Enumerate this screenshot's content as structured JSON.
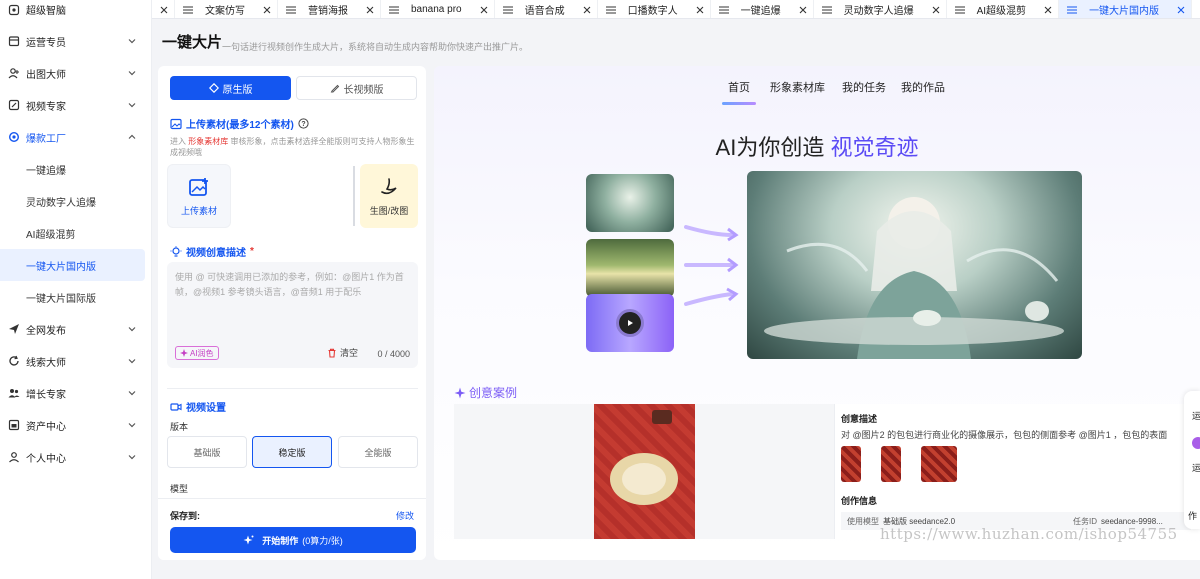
{
  "sidebar": {
    "items": [
      {
        "label": "超级智脑",
        "icon": "brain-icon"
      },
      {
        "label": "运营专员",
        "icon": "calendar-icon"
      },
      {
        "label": "出图大师",
        "icon": "user-plus-icon"
      },
      {
        "label": "视频专家",
        "icon": "video-edit-icon"
      },
      {
        "label": "爆款工厂",
        "icon": "gear-icon"
      },
      {
        "label": "全网发布",
        "icon": "send-icon"
      },
      {
        "label": "线索大师",
        "icon": "refresh-icon"
      },
      {
        "label": "增长专家",
        "icon": "user-group-icon"
      },
      {
        "label": "资产中心",
        "icon": "folder-icon"
      },
      {
        "label": "个人中心",
        "icon": "person-icon"
      }
    ],
    "subitems": [
      "一键追爆",
      "灵动数字人追爆",
      "AI超级混剪",
      "一键大片国内版",
      "一键大片国际版"
    ]
  },
  "tabs": [
    "",
    "文案仿写",
    "营销海报",
    "banana pro",
    "语音合成",
    "口播数字人",
    "一键追爆",
    "灵动数字人追爆",
    "AI超级混剪",
    "一键大片国内版"
  ],
  "page": {
    "title": "一键大片",
    "subtitle": "一句话进行视频创作生成大片，系统将自动生成内容帮助你快速产出推广片。"
  },
  "form": {
    "mode_primary": "原生版",
    "mode_secondary": "长视频版",
    "upload_title": "上传素材(最多12个素材)",
    "hint_prefix": "进入",
    "hint_link": "形象素材库",
    "hint_suffix": "审核形象，点击素材选择全能版则可支持人物形象生成视频哦",
    "upload_label": "上传素材",
    "gen_label": "生图/改图",
    "desc_title": "视频创意描述",
    "required_mark": "*",
    "desc_placeholder": "使用 @ 可快速调用已添加的参考，例如：@图片1 作为首帧，@视频1 参考镜头语言，@音频1 用于配乐",
    "ai_polish": "AI润色",
    "clear": "清空",
    "counter": "0 / 4000",
    "settings_title": "视频设置",
    "version_label": "版本",
    "versions": [
      "基础版",
      "稳定版",
      "全能版"
    ],
    "model_label": "模型",
    "save_to": "保存到:",
    "modify": "修改",
    "start": "开始制作",
    "start_cost": "(0算力/张)"
  },
  "content": {
    "nav": [
      "首页",
      "形象素材库",
      "我的任务",
      "我的作品"
    ],
    "hero_main": "AI为你创造",
    "hero_accent": "视觉奇迹",
    "case_title": "创意案例",
    "case_desc_label": "创意描述",
    "case_desc": "对 @图片2 的包包进行商业化的摄像展示，包包的侧面参考 @图片1 ，包包的表面",
    "case_info_label": "创作信息",
    "info_model_key": "使用模型",
    "info_model_val": "基础版  seedance2.0",
    "info_task_key": "任务ID",
    "info_task_val": "seedance-9998..."
  },
  "float_bar": [
    "运",
    "运",
    "作"
  ],
  "watermark": "https://www.huzhan.com/ishop54755",
  "colors": {
    "accent": "#1456f0",
    "purple": "#7b5cf6",
    "danger": "#e53935"
  }
}
